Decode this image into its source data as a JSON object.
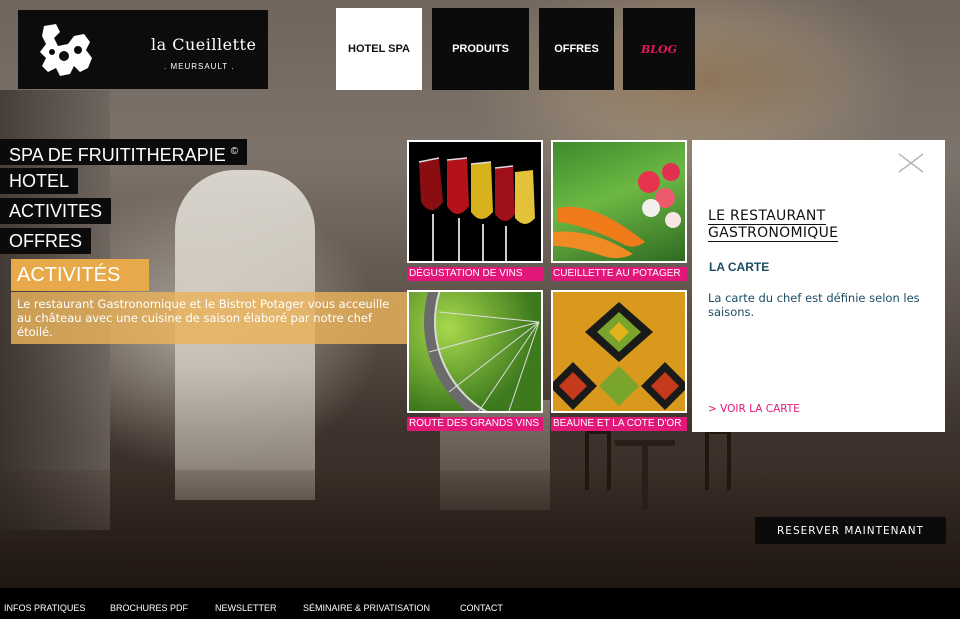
{
  "logo": {
    "brand": "la Cueillette",
    "sub": ". MEURSAULT ."
  },
  "topnav": [
    {
      "label": "HOTEL SPA",
      "active": true
    },
    {
      "label": "PRODUITS"
    },
    {
      "label": "OFFRES"
    },
    {
      "label": "BLOG"
    }
  ],
  "leftmenu": {
    "spa": "SPA DE FRUITITHERAPIE",
    "spa_mark": "©",
    "hotel": "HOTEL",
    "activites": "ACTIVITES",
    "offres": "OFFRES"
  },
  "section": {
    "title": "ACTIVITÉS",
    "description": "Le restaurant Gastronomique et le Bistrot Potager vous acceuille au château avec une cuisine de saison élaboré par notre chef étoilé."
  },
  "tiles": [
    {
      "caption": "DÉGUSTATION DE VINS",
      "image": "wine-glasses"
    },
    {
      "caption": "CUEILLETTE AU POTAGER",
      "image": "vegetables"
    },
    {
      "caption": "ROUTE DES GRANDS VINS",
      "image": "bicycle-wheel"
    },
    {
      "caption": "BEAUNE ET LA COTE D'OR",
      "image": "woven-pattern"
    }
  ],
  "panel": {
    "title_line1": "LE RESTAURANT",
    "title_line2": "GASTRONOMIQUE",
    "subtitle": "LA CARTE",
    "text": "La carte du chef est définie selon les saisons.",
    "link": "> VOIR LA CARTE",
    "close_icon": "close-x-icon"
  },
  "reserve_button": "RESERVER MAINTENANT",
  "footer": {
    "links": [
      "INFOS PRATIQUES",
      "BROCHURES PDF",
      "NEWSLETTER",
      "SÉMINAIRE & PRIVATISATION",
      "CONTACT"
    ]
  },
  "colors": {
    "accent_pink": "#e2177a",
    "accent_orange": "#e8a94a",
    "nav_black": "#0b0b0b",
    "panel_text": "#1b4c64"
  }
}
